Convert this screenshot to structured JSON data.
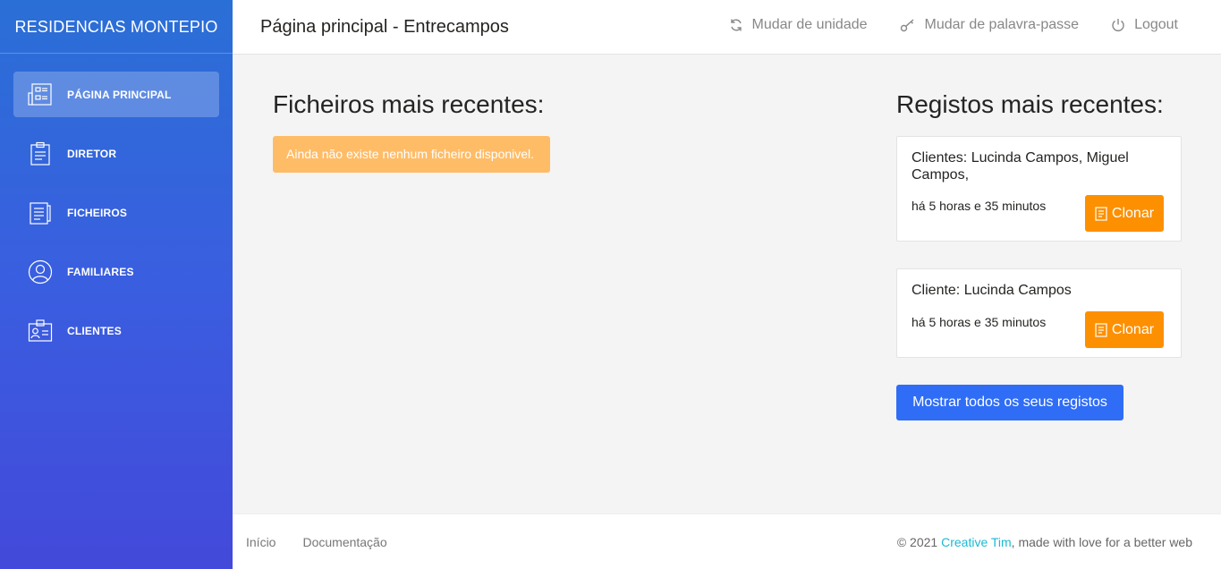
{
  "sidebar": {
    "brand": "RESIDENCIAS MONTEPIO",
    "items": [
      {
        "label": "PÁGINA PRINCIPAL",
        "icon": "dashboard-icon",
        "active": true
      },
      {
        "label": "DIRETOR",
        "icon": "clipboard-icon",
        "active": false
      },
      {
        "label": "FICHEIROS",
        "icon": "documents-icon",
        "active": false
      },
      {
        "label": "FAMILIARES",
        "icon": "user-circle-icon",
        "active": false
      },
      {
        "label": "CLIENTES",
        "icon": "id-badge-icon",
        "active": false
      }
    ]
  },
  "header": {
    "title": "Página principal - Entrecampos",
    "links": {
      "change_unit": "Mudar de unidade",
      "change_password": "Mudar de palavra-passe",
      "logout": "Logout"
    }
  },
  "files": {
    "title": "Ficheiros mais recentes:",
    "empty_message": "Ainda não existe nenhum ficheiro disponivel."
  },
  "records": {
    "title": "Registos mais recentes:",
    "items": [
      {
        "title": "Clientes: Lucinda Campos, Miguel Campos,",
        "time": "há 5 horas e 35 minutos",
        "button": "Clonar"
      },
      {
        "title": "Cliente: Lucinda Campos",
        "time": "há 5 horas e 35 minutos",
        "button": "Clonar"
      }
    ],
    "show_all": "Mostrar todos os seus registos"
  },
  "footer": {
    "links": [
      "Início",
      "Documentação"
    ],
    "copy_prefix": "© 2021 ",
    "copy_brand": "Creative Tim",
    "copy_suffix": ", made with love for a better web"
  },
  "colors": {
    "sidebar_top": "#2a6fd6",
    "sidebar_bottom": "#4349da",
    "warning": "#ffbc67",
    "clone_button": "#fd9000",
    "primary_button": "#2f6df6",
    "footer_accent": "#1bb9d4"
  }
}
